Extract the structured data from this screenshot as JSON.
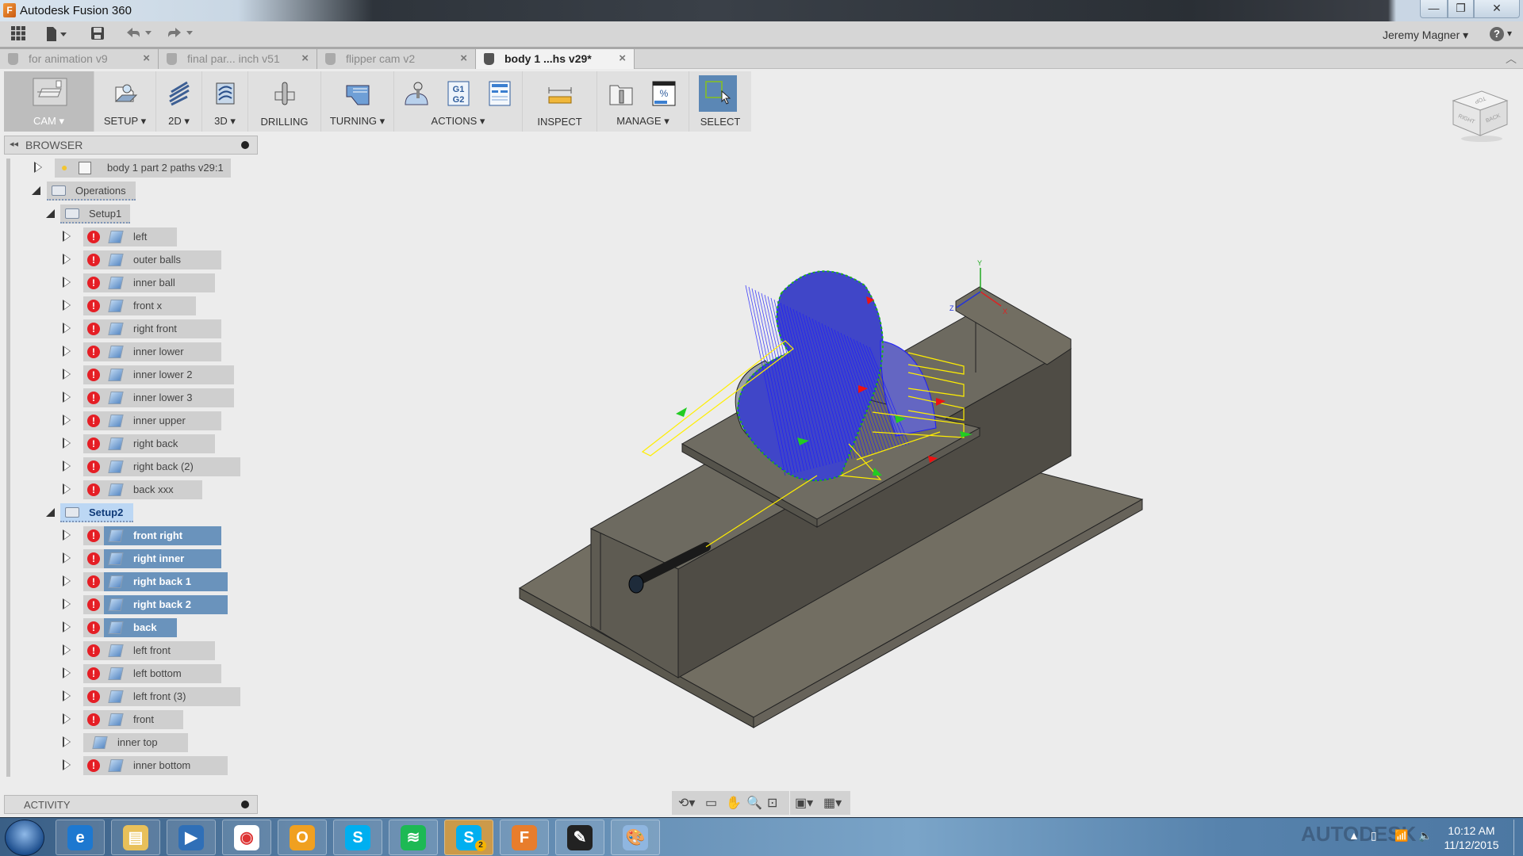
{
  "window": {
    "app_title": "Autodesk Fusion 360",
    "controls": {
      "minimize": "—",
      "maximize": "❐",
      "close": "✕"
    }
  },
  "quickbar": {
    "icons": [
      "apps-grid-icon",
      "file-icon",
      "save-icon",
      "undo-icon",
      "redo-icon"
    ],
    "user_name": "Jeremy Magner",
    "help_glyph": "?"
  },
  "tabs": [
    {
      "label": "for animation v9",
      "active": false
    },
    {
      "label": "final par... inch v51",
      "active": false
    },
    {
      "label": "flipper cam v2",
      "active": false
    },
    {
      "label": "body 1 ...hs v29*",
      "active": true
    }
  ],
  "ribbon": {
    "workspace": "CAM ▾",
    "groups": [
      {
        "label": "SETUP ▾"
      },
      {
        "label": "2D ▾"
      },
      {
        "label": "3D ▾"
      },
      {
        "label": "DRILLING"
      },
      {
        "label": "TURNING ▾"
      },
      {
        "label": "ACTIONS ▾"
      },
      {
        "label": "INSPECT"
      },
      {
        "label": "MANAGE ▾"
      },
      {
        "label": "SELECT"
      }
    ],
    "actions_g1g2": "G1\nG2",
    "manage_percent": "%"
  },
  "browser": {
    "title": "BROWSER",
    "root": {
      "label": "body 1 part 2 paths v29:1"
    },
    "operations_label": "Operations",
    "setups": [
      {
        "label": "Setup1",
        "selected": false,
        "operations": [
          {
            "label": "left",
            "error": true,
            "selected": false
          },
          {
            "label": "outer balls",
            "error": true,
            "selected": false
          },
          {
            "label": "inner ball",
            "error": true,
            "selected": false
          },
          {
            "label": "front x",
            "error": true,
            "selected": false
          },
          {
            "label": "right front",
            "error": true,
            "selected": false
          },
          {
            "label": "inner lower",
            "error": true,
            "selected": false
          },
          {
            "label": "inner lower 2",
            "error": true,
            "selected": false
          },
          {
            "label": "inner lower 3",
            "error": true,
            "selected": false
          },
          {
            "label": "inner upper",
            "error": true,
            "selected": false
          },
          {
            "label": "right back",
            "error": true,
            "selected": false
          },
          {
            "label": "right back (2)",
            "error": true,
            "selected": false
          },
          {
            "label": "back xxx",
            "error": true,
            "selected": false
          }
        ]
      },
      {
        "label": "Setup2",
        "selected": true,
        "operations": [
          {
            "label": "front right",
            "error": true,
            "selected": true
          },
          {
            "label": "right inner",
            "error": true,
            "selected": true
          },
          {
            "label": "right back 1",
            "error": true,
            "selected": true
          },
          {
            "label": "right back 2",
            "error": true,
            "selected": true
          },
          {
            "label": "back",
            "error": true,
            "selected": true
          },
          {
            "label": "left front",
            "error": true,
            "selected": false
          },
          {
            "label": "left bottom",
            "error": true,
            "selected": false
          },
          {
            "label": "left front (3)",
            "error": true,
            "selected": false
          },
          {
            "label": "front",
            "error": true,
            "selected": false
          },
          {
            "label": "inner top",
            "error": false,
            "selected": false
          },
          {
            "label": "inner bottom",
            "error": true,
            "selected": false
          }
        ]
      }
    ]
  },
  "activity": {
    "title": "ACTIVITY"
  },
  "viewcube": {
    "faces": [
      "TOP",
      "RIGHT",
      "BACK"
    ]
  },
  "viewport": {
    "axis_labels": {
      "x": "X",
      "y": "Y",
      "z": "Z"
    },
    "colors": {
      "toolpath": "#1a1aff",
      "lead": "#ffff00",
      "stock": "#6e6b62",
      "arrow_green": "#22cc22",
      "arrow_red": "#ee1111"
    }
  },
  "navbar": {
    "icons": [
      "orbit-icon",
      "look-at-icon",
      "pan-icon",
      "zoom-icon",
      "fit-icon",
      "display-settings-icon",
      "grid-icon"
    ]
  },
  "taskbar": {
    "apps": [
      "internet-explorer",
      "file-explorer",
      "media-player",
      "chrome",
      "outlook",
      "skype",
      "spotify",
      "skype-2",
      "fusion-360",
      "inkscape",
      "paint"
    ],
    "skype_badge": "2",
    "clock_time": "10:12 AM",
    "clock_date": "11/12/2015",
    "tray_bg_text": "AUTODESK"
  }
}
